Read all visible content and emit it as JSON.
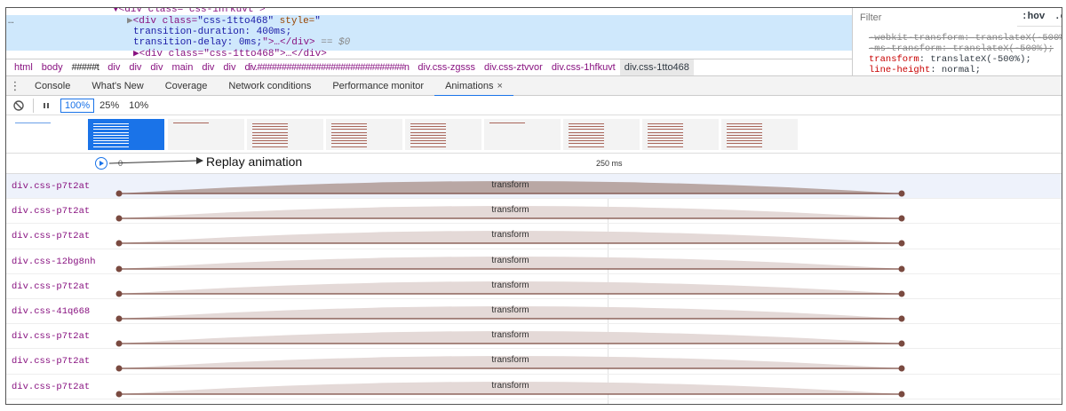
{
  "elements": {
    "line0": "▼<div class=\"css-1hfkuvt\">",
    "selected_tag_open": "<div class=",
    "selected_class": "\"css-1tto468\"",
    "selected_style_attr": " style=",
    "selected_style_quote": "\"",
    "selected_duration": "transition-duration: 400ms;",
    "selected_delay": "transition-delay: 0ms;",
    "selected_tail": "\">…</div>",
    "selected_eq": " == $0",
    "line_next": "▶<div class=\"css-1tto468\">…</div>",
    "ellipsis": "…"
  },
  "styles": {
    "filter_placeholder": "Filter",
    "hov_label": ":hov",
    "cls_label": ".c",
    "lines": [
      {
        "prop": "-webkit-transform",
        "value": "translateX(-500%);",
        "struck": true
      },
      {
        "prop": "-ms-transform",
        "value": "translateX(-500%);",
        "struck": true
      },
      {
        "prop": "transform",
        "value": "translateX(-500%);",
        "struck": false
      },
      {
        "prop": "line-height",
        "value": "normal;",
        "struck": false
      }
    ]
  },
  "breadcrumb": [
    "html",
    "body",
    "#####t",
    "div",
    "div",
    "div",
    "main",
    "div",
    "div",
    "div.##############################n",
    "div.css-zgsss",
    "div.css-ztvvor",
    "div.css-1hfkuvt",
    "div.css-1tto468"
  ],
  "drawer_tabs": [
    "Console",
    "What's New",
    "Coverage",
    "Network conditions",
    "Performance monitor",
    "Animations"
  ],
  "drawer_close": "×",
  "controls": {
    "speeds": [
      "100%",
      "25%",
      "10%"
    ],
    "active_speed": "100%"
  },
  "timeline": {
    "tick_start": "0",
    "tick_mid": "250 ms",
    "annotation": "Replay animation"
  },
  "rows": [
    {
      "label": "div.css-p7t2at",
      "name": "transform",
      "selected": true
    },
    {
      "label": "div.css-p7t2at",
      "name": "transform",
      "selected": false
    },
    {
      "label": "div.css-p7t2at",
      "name": "transform",
      "selected": false
    },
    {
      "label": "div.css-12bg8nh",
      "name": "transform",
      "selected": false
    },
    {
      "label": "div.css-p7t2at",
      "name": "transform",
      "selected": false
    },
    {
      "label": "div.css-41q668",
      "name": "transform",
      "selected": false
    },
    {
      "label": "div.css-p7t2at",
      "name": "transform",
      "selected": false
    },
    {
      "label": "div.css-p7t2at",
      "name": "transform",
      "selected": false
    },
    {
      "label": "div.css-p7t2at",
      "name": "transform",
      "selected": false
    }
  ],
  "colors": {
    "accent": "#1a73e8",
    "curve_selected": "#b9a7a4",
    "curve": "#e4d9d7",
    "line": "#7a4a40"
  }
}
